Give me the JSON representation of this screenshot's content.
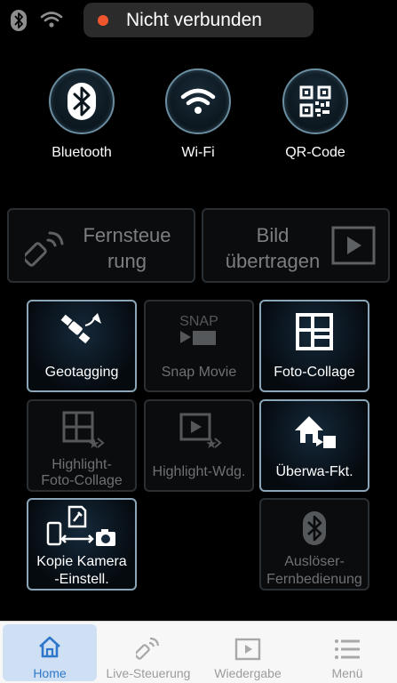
{
  "status": {
    "connection_text": "Nicht verbunden",
    "dot_color": "#f0562e"
  },
  "connections": [
    {
      "label": "Bluetooth",
      "icon": "bluetooth-icon"
    },
    {
      "label": "Wi-Fi",
      "icon": "wifi-icon"
    },
    {
      "label": "QR-Code",
      "icon": "qr-code-icon"
    }
  ],
  "features": {
    "remote_line1": "Fernsteue",
    "remote_line2": "rung",
    "transfer_line1": "Bild",
    "transfer_line2": "übertragen"
  },
  "tiles": {
    "geotagging": {
      "label": "Geotagging",
      "enabled": true
    },
    "snap_movie": {
      "label": "Snap Movie",
      "icon_text": "SNAP",
      "enabled": false
    },
    "photo_collage": {
      "label": "Foto-Collage",
      "enabled": true
    },
    "highlight_collage": {
      "line1": "Highlight-",
      "line2": "Foto-Collage",
      "enabled": false
    },
    "highlight_movie": {
      "label": "Highlight-Wdg.",
      "enabled": false
    },
    "monitoring": {
      "label": "Überwa-Fkt.",
      "enabled": true
    },
    "copy_settings": {
      "line1": "Kopie Kamera",
      "line2": "-Einstell.",
      "enabled": true
    },
    "shutter_remote": {
      "line1": "Auslöser-",
      "line2": "Fernbedienung",
      "enabled": false
    }
  },
  "tabbar": {
    "home": "Home",
    "live": "Live-Steuerung",
    "playback": "Wiedergabe",
    "menu": "Menü",
    "active": "home",
    "accent_color": "#2f78c9"
  }
}
